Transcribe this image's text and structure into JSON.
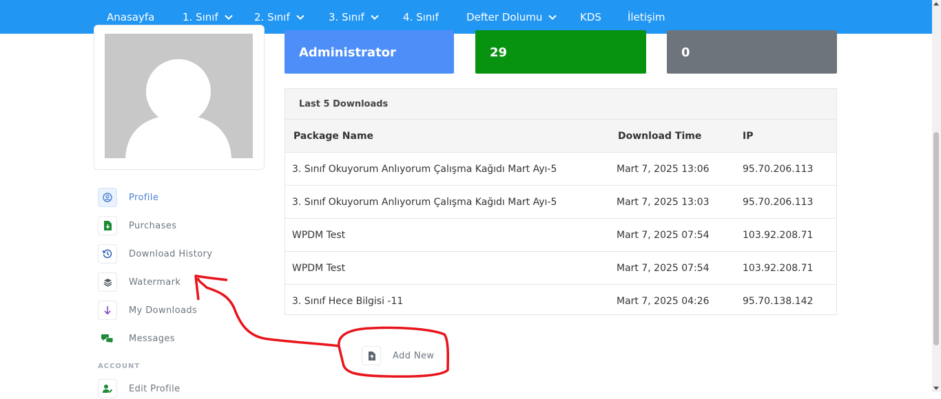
{
  "nav": {
    "items": [
      {
        "label": "Anasayfa",
        "dropdown": false
      },
      {
        "label": "1. Sınıf",
        "dropdown": true
      },
      {
        "label": "2. Sınıf",
        "dropdown": true
      },
      {
        "label": "3. Sınıf",
        "dropdown": true
      },
      {
        "label": "4. Sınıf",
        "dropdown": false
      },
      {
        "label": "Defter Dolumu",
        "dropdown": true
      },
      {
        "label": "KDS",
        "dropdown": false
      },
      {
        "label": "İletişim",
        "dropdown": false
      }
    ],
    "color": "#2196f3"
  },
  "stats": [
    {
      "value": "Administrator",
      "color": "#4d8ef8"
    },
    {
      "value": "29",
      "color": "#07920f"
    },
    {
      "value": "0",
      "color": "#6e747b"
    }
  ],
  "menu": {
    "items": [
      {
        "label": "Profile",
        "icon": "user-circle-icon",
        "active": true
      },
      {
        "label": "Purchases",
        "icon": "file-download-icon",
        "active": false
      },
      {
        "label": "Download History",
        "icon": "history-icon",
        "active": false
      },
      {
        "label": "Watermark",
        "icon": "layers-icon",
        "active": false
      },
      {
        "label": "My Downloads",
        "icon": "arrow-down-icon",
        "active": false
      },
      {
        "label": "Messages",
        "icon": "chat-icon",
        "active": false
      }
    ],
    "section_account": "ACCOUNT",
    "edit_profile": "Edit Profile"
  },
  "downloads": {
    "title": "Last 5 Downloads",
    "columns": [
      "Package Name",
      "Download Time",
      "IP"
    ],
    "rows": [
      [
        "3. Sınıf Okuyorum Anlıyorum Çalışma Kağıdı Mart Ayı-5",
        "Mart 7, 2025 13:06",
        "95.70.206.113"
      ],
      [
        "3. Sınıf Okuyorum Anlıyorum Çalışma Kağıdı Mart Ayı-5",
        "Mart 7, 2025 13:03",
        "95.70.206.113"
      ],
      [
        "WPDM Test",
        "Mart 7, 2025 07:54",
        "103.92.208.71"
      ],
      [
        "WPDM Test",
        "Mart 7, 2025 07:54",
        "103.92.208.71"
      ],
      [
        "3. Sınıf Hece Bilgisi -11",
        "Mart 7, 2025 04:26",
        "95.70.138.142"
      ]
    ]
  },
  "add_new": {
    "label": "Add New",
    "icon": "file-plus-icon"
  },
  "annotation_color": "#e8141b"
}
